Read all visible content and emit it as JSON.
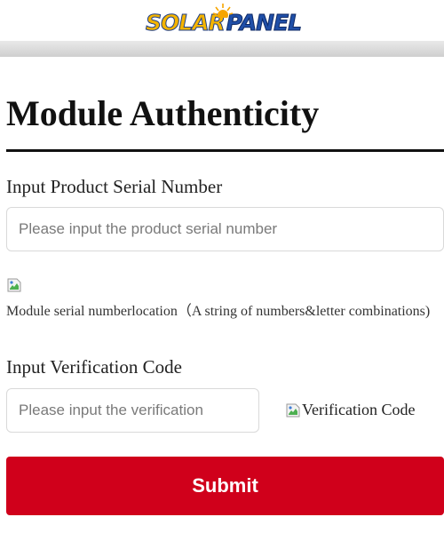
{
  "logo": {
    "part1": "SOLAR",
    "part2": "PANEL"
  },
  "page": {
    "title": "Module Authenticity"
  },
  "serial": {
    "label": "Input Product Serial Number",
    "placeholder": "Please input the product serial number",
    "value": ""
  },
  "hint": {
    "image_icon": "broken-image-icon",
    "text": "Module serial numberlocation（A string of numbers&letter combinations)"
  },
  "verification": {
    "label": "Input Verification Code",
    "placeholder": "Please input the verification",
    "value": "",
    "image_alt": "Verification Code",
    "image_icon": "broken-image-icon"
  },
  "submit": {
    "label": "Submit"
  },
  "colors": {
    "accent": "#d0001b",
    "logo_yellow": "#f4b400",
    "logo_blue": "#1f4fa8"
  }
}
